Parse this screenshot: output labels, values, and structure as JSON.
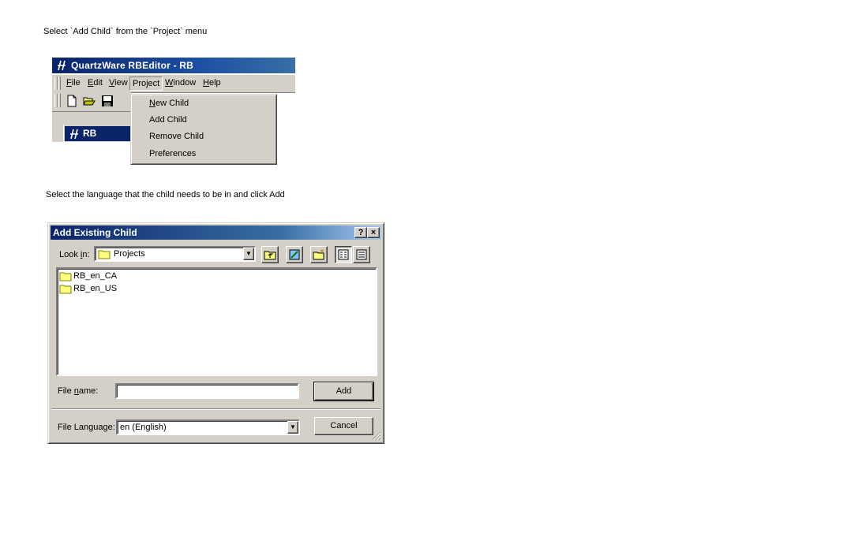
{
  "instructions": {
    "step1": "Select `Add Child` from the `Project` menu",
    "step2": "Select the language that the child needs to be in and click Add"
  },
  "app": {
    "title": "QuartzWare RBEditor -  RB",
    "menubar": [
      "File",
      "Edit",
      "View",
      "Project",
      "Window",
      "Help"
    ],
    "active_menu": "Project",
    "child_window_title": "RB",
    "toolbar_icons": [
      "new-document-icon",
      "open-folder-icon",
      "save-disk-icon"
    ]
  },
  "project_menu": {
    "items": [
      "New  Child",
      "Add Child",
      "Remove Child",
      "Preferences"
    ]
  },
  "dialog": {
    "title": "Add Existing Child",
    "help_button": "?",
    "close_button": "×",
    "look_in_label": "Look in:",
    "look_in_value": "Projects",
    "toolbar_icons": [
      "up-one-level-icon",
      "desktop-icon",
      "new-folder-icon",
      "list-view-icon",
      "details-view-icon"
    ],
    "files": [
      "RB_en_CA",
      "RB_en_US"
    ],
    "file_name_label": "File name:",
    "file_name_value": "",
    "add_button": "Add",
    "file_language_label": "File Language:",
    "file_language_value": "en (English)",
    "cancel_button": "Cancel"
  },
  "colors": {
    "titlebar": "#0a246a",
    "titlebar_end": "#a6caf0",
    "face": "#d4d0c8"
  }
}
